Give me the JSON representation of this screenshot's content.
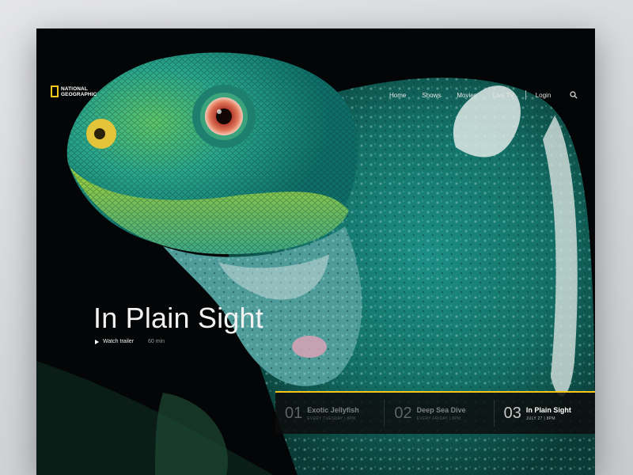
{
  "brand": {
    "name_line1": "NATIONAL",
    "name_line2": "GEOGRAPHIC",
    "accent": "#f5c518"
  },
  "nav": {
    "items": [
      "Home",
      "Shows",
      "Movies",
      "Live TV"
    ],
    "login": "Login",
    "search_icon": "search-icon"
  },
  "hero": {
    "title": "In Plain Sight",
    "watch_label": "Watch trailer",
    "duration": "60 min",
    "image": "iguana-closeup"
  },
  "episodes": [
    {
      "num": "01",
      "title": "Exotic Jellyfish",
      "schedule": "EVERY TUESDAY | 8PM",
      "active": false
    },
    {
      "num": "02",
      "title": "Deep Sea Dive",
      "schedule": "EVERY FRIDAY | 8PM",
      "active": false
    },
    {
      "num": "03",
      "title": "In Plain Sight",
      "schedule": "JULY 27 | 8PM",
      "active": true
    }
  ]
}
